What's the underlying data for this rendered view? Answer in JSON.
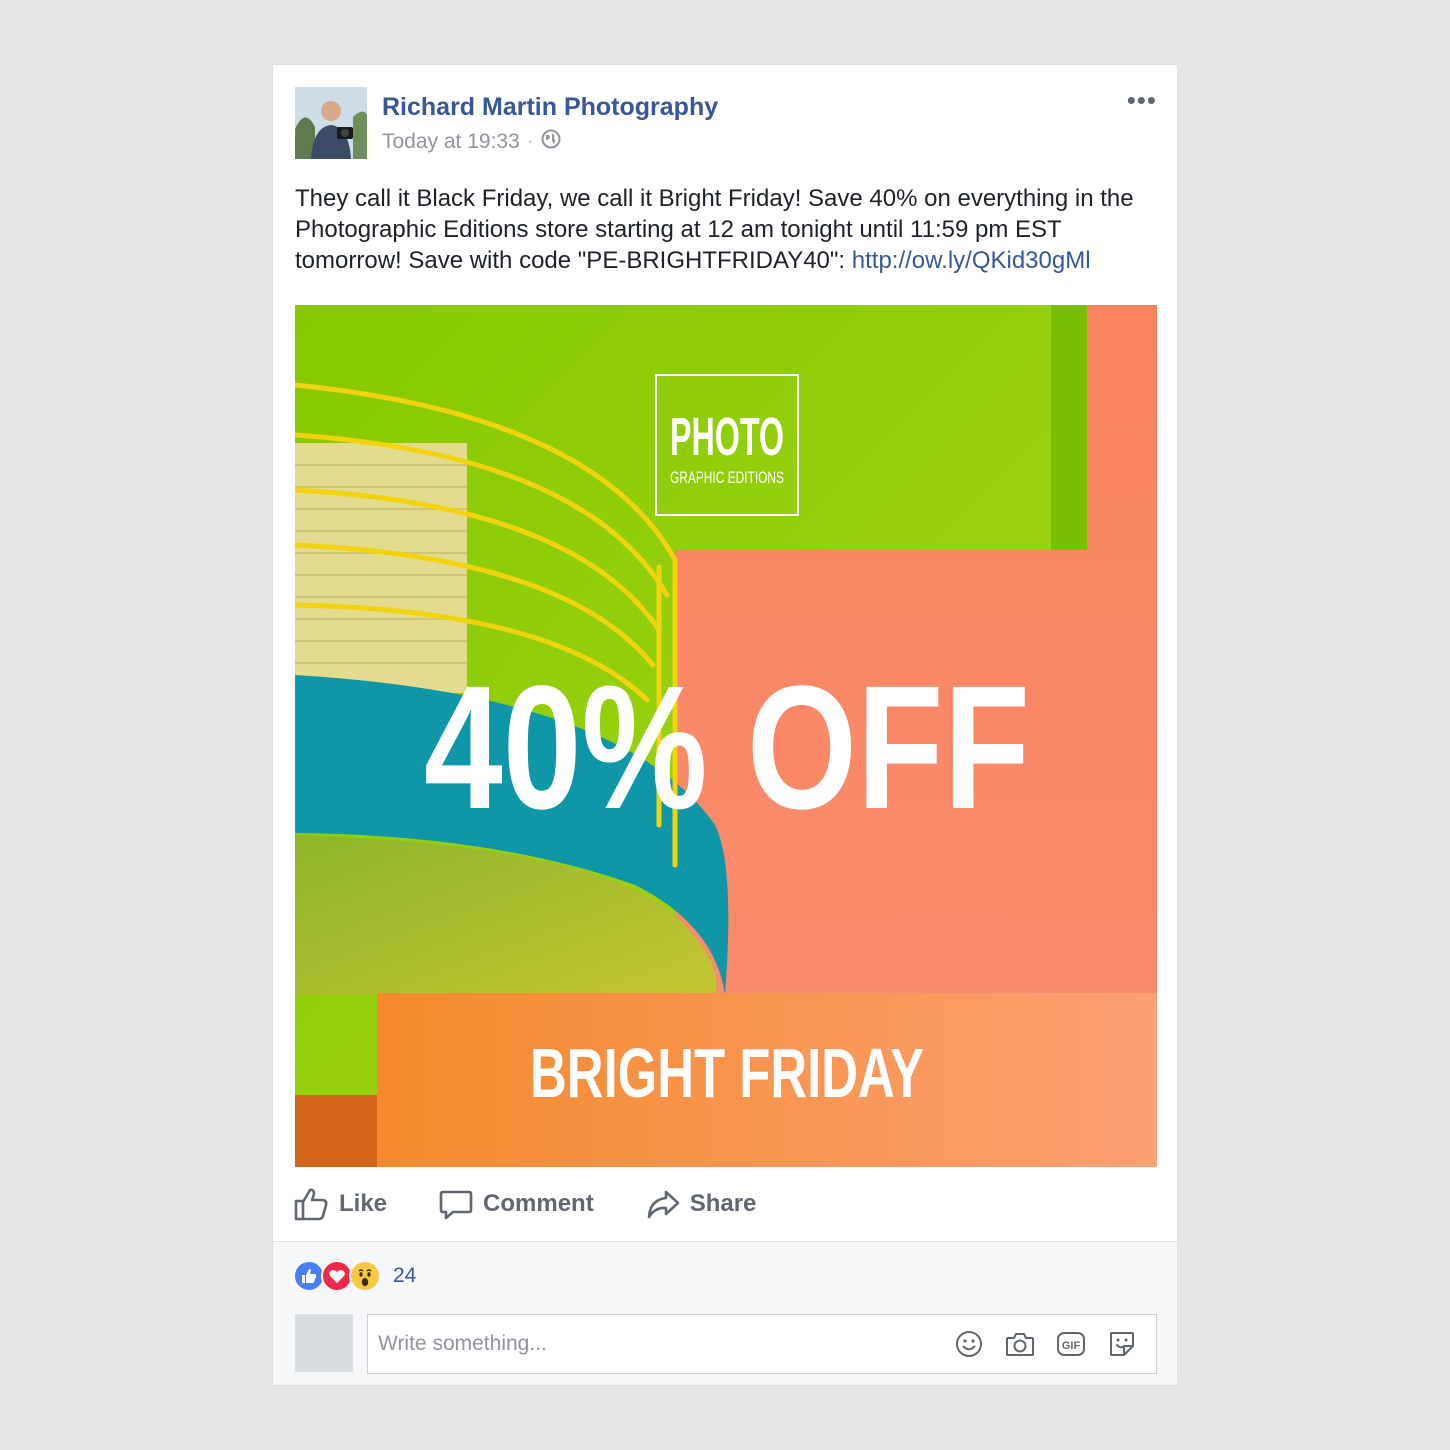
{
  "post": {
    "page_name": "Richard Martin Photography",
    "timestamp": "Today at 19:33",
    "separator": "·",
    "more_label": "•••",
    "text": "They call it Black Friday, we call it Bright Friday! Save 40% on everything in the Photographic Editions store starting at 12 am tonight until 11:59 pm EST tomorrow! Save with code \"PE-BRIGHTFRIDAY40\": ",
    "link": "http://ow.ly/QKid30gMl",
    "privacy_icon": "globe-icon"
  },
  "promo_image": {
    "logo_top": "PHOTO",
    "logo_bottom": "GRAPHIC EDITIONS",
    "headline": "40% OFF",
    "subline": "BRIGHT FRIDAY"
  },
  "actions": {
    "like": "Like",
    "comment": "Comment",
    "share": "Share"
  },
  "reactions": {
    "types": [
      "like-icon",
      "love-icon",
      "wow-icon"
    ],
    "count": "24"
  },
  "comment": {
    "placeholder": "Write something...",
    "gif_label": "GIF",
    "tools": [
      "emoji-icon",
      "camera-icon",
      "gif-icon",
      "sticker-icon"
    ]
  },
  "colors": {
    "link": "#365899",
    "like_blue": "#4a7ef4",
    "love_red": "#f0284a",
    "wow_yellow": "#f7c844",
    "promo_green": "#8cc90f",
    "promo_coral": "#fb8a6b",
    "promo_teal": "#109aaa",
    "promo_orange": "#f48f38"
  }
}
